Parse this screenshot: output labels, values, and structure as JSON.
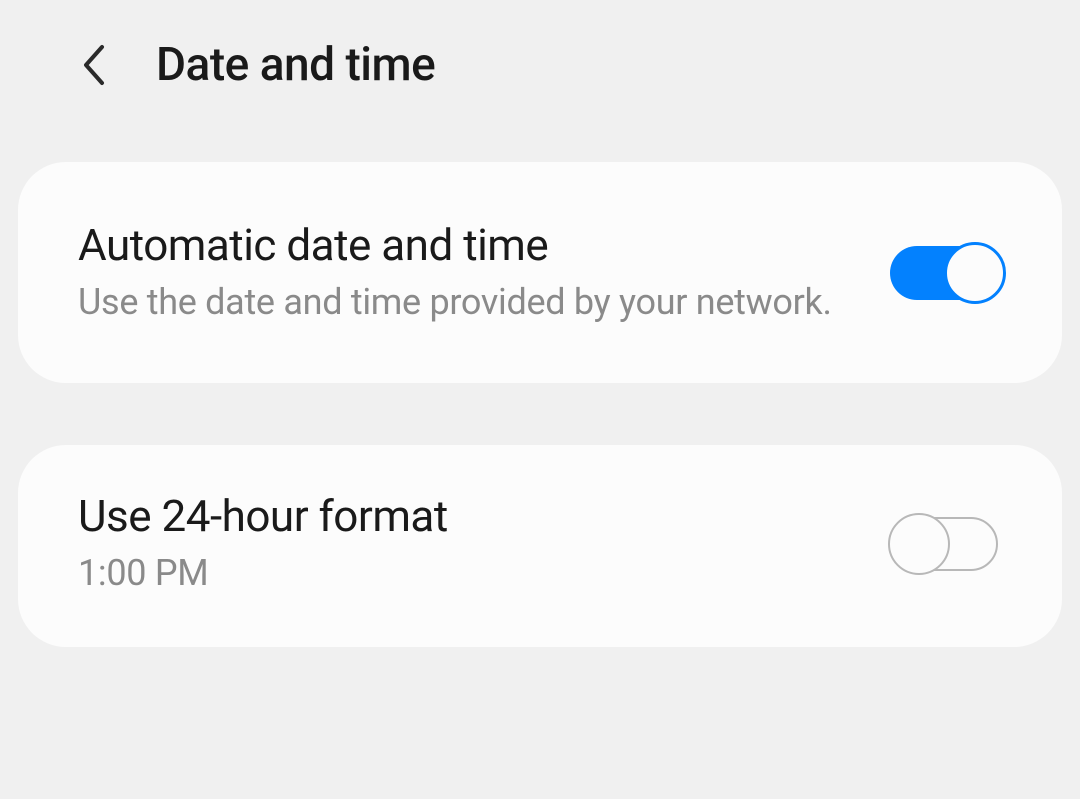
{
  "header": {
    "title": "Date and time"
  },
  "settings": {
    "automatic": {
      "title": "Automatic date and time",
      "subtitle": "Use the date and time provided by your network.",
      "enabled": true
    },
    "format24": {
      "title": "Use 24-hour format",
      "subtitle": "1:00 PM",
      "enabled": false
    }
  },
  "colors": {
    "accent": "#0381fe",
    "background": "#f0f0f0",
    "card": "#fcfcfc",
    "textPrimary": "#1a1a1a",
    "textSecondary": "#8a8a8a"
  }
}
